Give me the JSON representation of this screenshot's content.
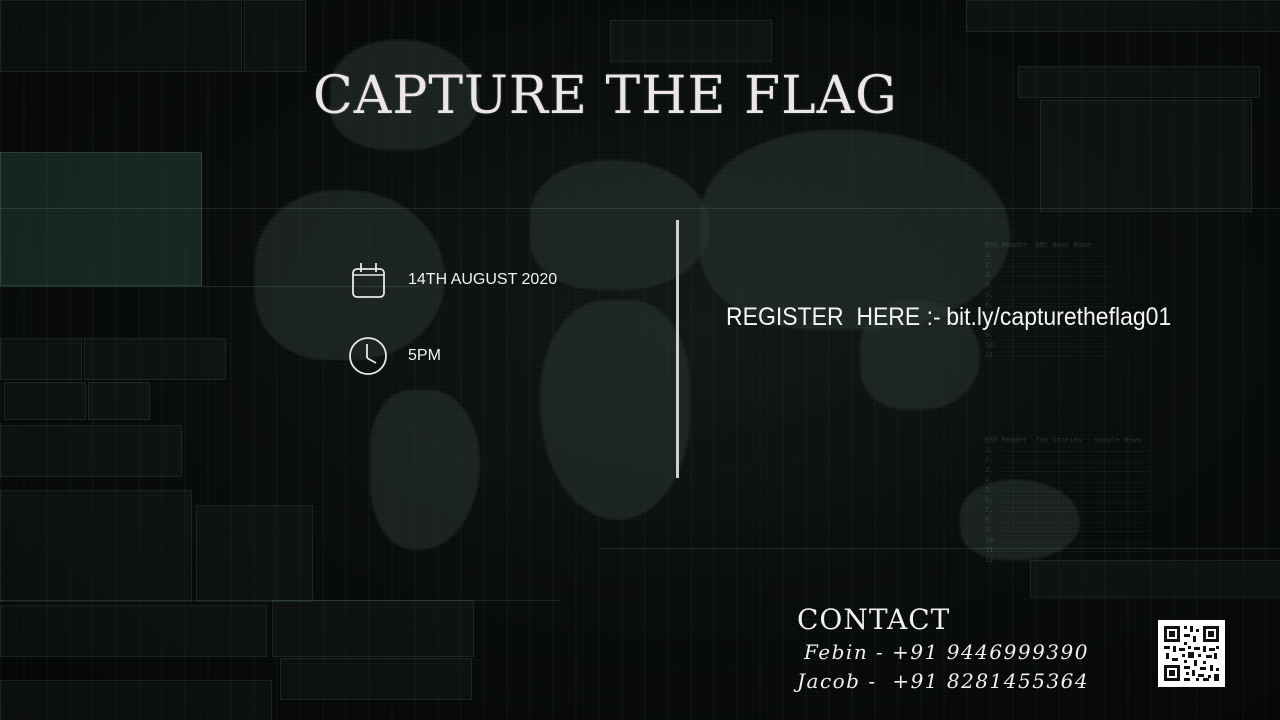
{
  "poster": {
    "title": "CAPTURE THE FLAG",
    "date": {
      "icon": "calendar-icon",
      "text": "14TH  AUGUST 2020"
    },
    "time": {
      "icon": "clock-icon",
      "text": "5PM"
    },
    "register": {
      "label": "REGISTER  HERE :-",
      "link": "bit.ly/capturetheflag01"
    },
    "contact": {
      "heading": "CONTACT",
      "people": [
        {
          "text": "Febin - +91 9446999390"
        },
        {
          "text": "Jacob -  +91 8281455364"
        }
      ]
    },
    "qr_code": {
      "icon": "qr-code-icon"
    }
  },
  "colors": {
    "background": "#050707",
    "text": "#f0f0f0",
    "divider": "#cfcfcf",
    "hud_accent": "#3a5a54"
  }
}
